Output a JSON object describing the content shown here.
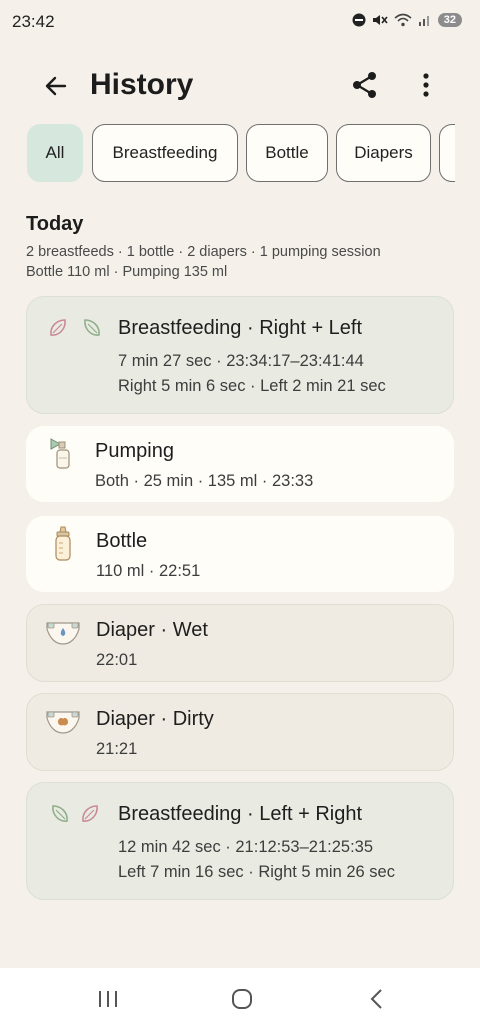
{
  "status": {
    "time": "23:42",
    "battery": "32",
    "icons": [
      "dnd-icon",
      "mute-icon",
      "wifi-icon",
      "signal-icon",
      "battery-icon"
    ]
  },
  "app_bar": {
    "title": "History",
    "icons": [
      "back-arrow-icon",
      "share-icon",
      "more-vert-icon"
    ]
  },
  "filters": {
    "chips": [
      {
        "label": "All",
        "selected": true
      },
      {
        "label": "Breastfeeding",
        "selected": false
      },
      {
        "label": "Bottle",
        "selected": false
      },
      {
        "label": "Diapers",
        "selected": false
      }
    ]
  },
  "today": {
    "title": "Today",
    "summary_line1": "2 breastfeeds · 1 bottle · 2 diapers · 1 pumping session",
    "summary_line2": "Bottle 110 ml · Pumping 135 ml"
  },
  "entries": [
    {
      "type": "breastfeeding",
      "title": "Breastfeeding · Right + Left",
      "line1": "7 min 27 sec · 23:34:17–23:41:44",
      "line2": "Right 5 min 6 sec · Left 2 min 21 sec"
    },
    {
      "type": "pumping",
      "title": "Pumping",
      "line1": "Both · 25 min · 135 ml · 23:33"
    },
    {
      "type": "bottle",
      "title": "Bottle",
      "line1": "110 ml · 22:51"
    },
    {
      "type": "diaper-wet",
      "title": "Diaper · Wet",
      "line1": "22:01"
    },
    {
      "type": "diaper-dirty",
      "title": "Diaper · Dirty",
      "line1": "21:21"
    },
    {
      "type": "breastfeeding",
      "title": "Breastfeeding · Left + Right",
      "line1": "12 min 42 sec · 21:12:53–21:25:35",
      "line2": "Left 7 min 16 sec · Right 5 min 26 sec"
    }
  ],
  "colors": {
    "background": "#f5f1ea",
    "chip_selected": "#d6e8de",
    "breastfeeding_card": "#e9ebe3",
    "neutral_card": "#fffdf8",
    "diaper_card": "#f0ebe2",
    "left_leaf": "#8fae8a",
    "right_leaf": "#c98a95"
  },
  "nav": {
    "icons": [
      "recents-icon",
      "home-icon",
      "back-icon"
    ]
  }
}
